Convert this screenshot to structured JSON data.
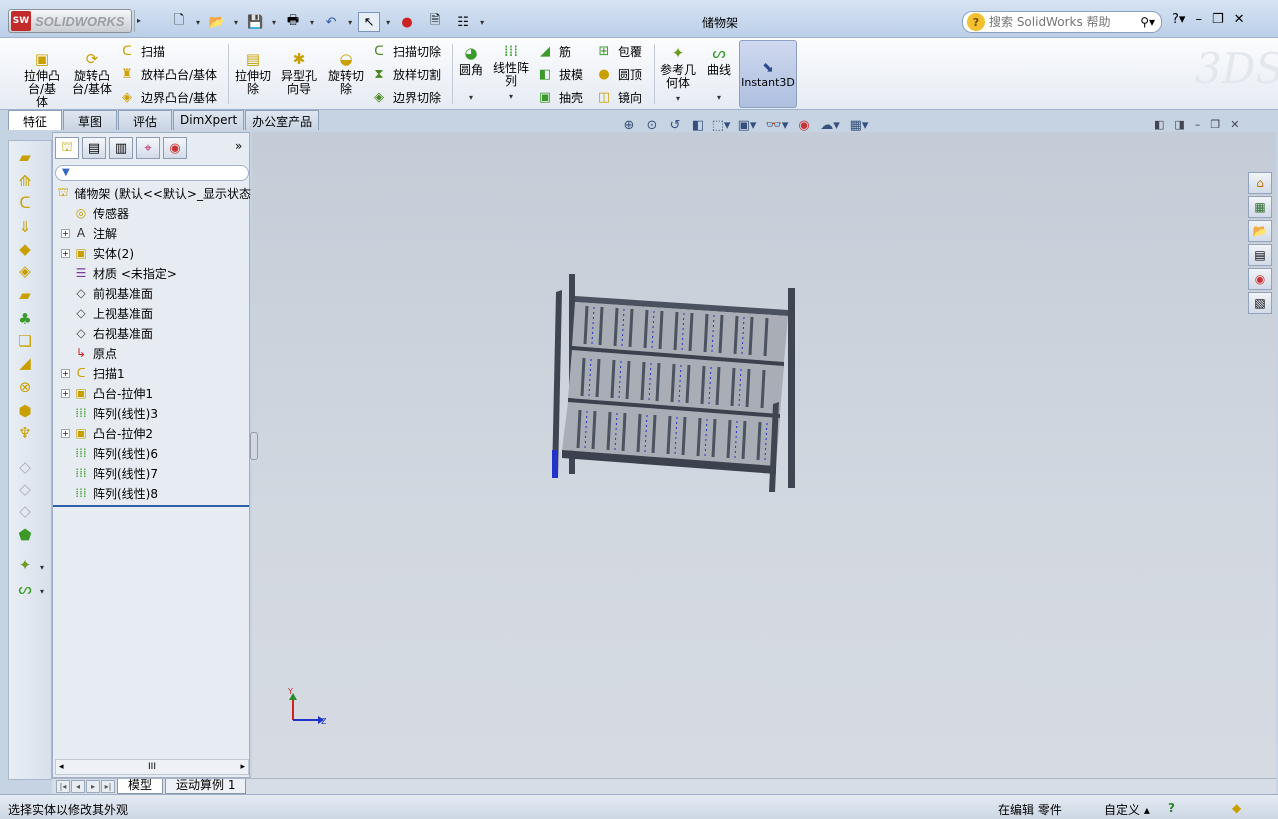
{
  "app": {
    "brand": "SOLIDWORKS",
    "brand_badge": "SW",
    "window_title": "储物架",
    "help_search_placeholder": "搜索 SolidWorks 帮助",
    "help_q": "?"
  },
  "command_manager": {
    "extrude_boss": "拉伸凸\n台/基体",
    "revolve_boss": "旋转凸\n台/基体",
    "sweep": "扫描",
    "loft_boss": "放样凸台/基体",
    "boundary_boss": "边界凸台/基体",
    "extrude_cut": "拉伸切\n除",
    "hole_wizard": "异型孔\n向导",
    "revolve_cut": "旋转切\n除",
    "swept_cut": "扫描切除",
    "lofted_cut": "放样切割",
    "boundary_cut": "边界切除",
    "fillet": "圆角",
    "linear_pattern": "线性阵\n列",
    "rib": "筋",
    "draft": "拔模",
    "shell": "抽壳",
    "wrap": "包覆",
    "dome": "圆顶",
    "mirror": "镜向",
    "ref_geometry": "参考几\n何体",
    "curves": "曲线",
    "instant3d": "Instant3D",
    "watermark": "3DS"
  },
  "tabs": [
    "特征",
    "草图",
    "评估",
    "DimXpert",
    "办公室产品"
  ],
  "feature_tree": {
    "root": "储物架 (默认<<默认>_显示状态",
    "items": [
      {
        "label": "传感器",
        "icon": "sensor-icon",
        "expandable": false
      },
      {
        "label": "注解",
        "icon": "annotation-icon",
        "expandable": true
      },
      {
        "label": "实体(2)",
        "icon": "solid-bodies-icon",
        "expandable": true
      },
      {
        "label": "材质 <未指定>",
        "icon": "material-icon",
        "expandable": false
      },
      {
        "label": "前视基准面",
        "icon": "plane-icon",
        "expandable": false
      },
      {
        "label": "上视基准面",
        "icon": "plane-icon",
        "expandable": false
      },
      {
        "label": "右视基准面",
        "icon": "plane-icon",
        "expandable": false
      },
      {
        "label": "原点",
        "icon": "origin-icon",
        "expandable": false
      },
      {
        "label": "扫描1",
        "icon": "sweep-feature-icon",
        "expandable": true
      },
      {
        "label": "凸台-拉伸1",
        "icon": "extrude-feature-icon",
        "expandable": true
      },
      {
        "label": "阵列(线性)3",
        "icon": "linear-pattern-icon",
        "expandable": false
      },
      {
        "label": "凸台-拉伸2",
        "icon": "extrude-feature-icon",
        "expandable": true
      },
      {
        "label": "阵列(线性)6",
        "icon": "linear-pattern-icon",
        "expandable": false
      },
      {
        "label": "阵列(线性)7",
        "icon": "linear-pattern-icon",
        "expandable": false
      },
      {
        "label": "阵列(线性)8",
        "icon": "linear-pattern-icon",
        "expandable": false
      }
    ],
    "hscroll_mid": "III"
  },
  "triad": {
    "y": "Y",
    "z": "Z"
  },
  "bottom_tabs": [
    "模型",
    "运动算例 1"
  ],
  "status": {
    "message": "选择实体以修改其外观",
    "editing": "在编辑 零件",
    "custom": "自定义"
  },
  "colors": {
    "accent": "#2f5fa5",
    "model_dark": "#3f4652",
    "model_blue": "#2233cc"
  }
}
